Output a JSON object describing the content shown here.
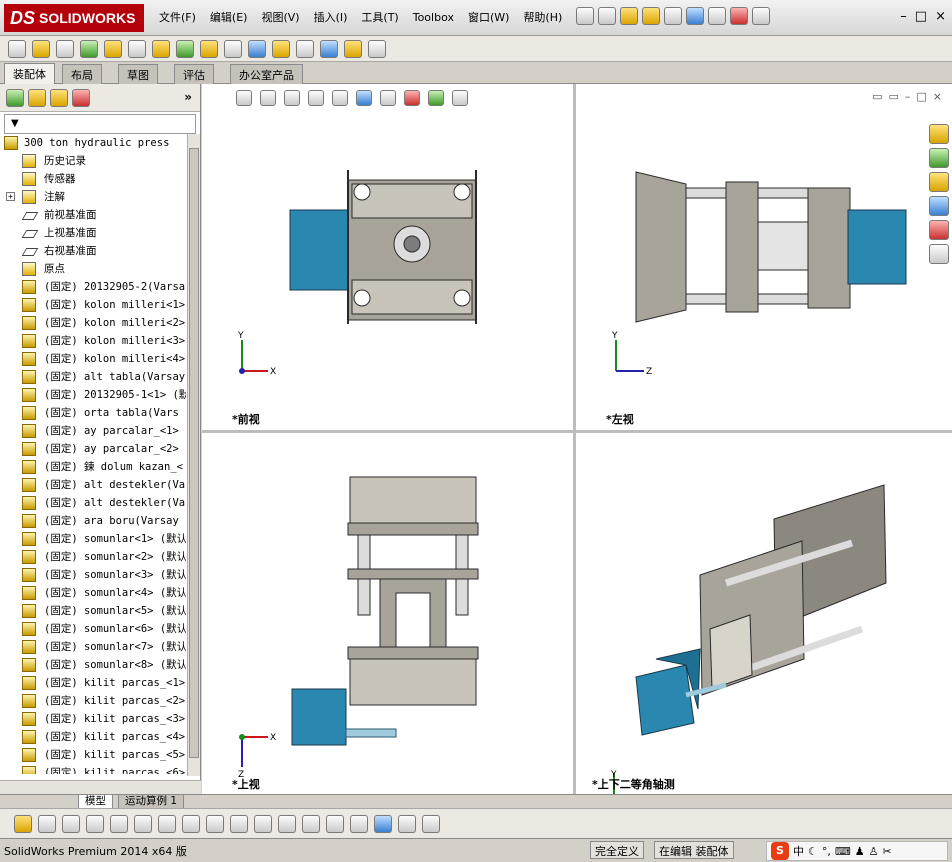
{
  "app": {
    "logo_prefix": "DS",
    "logo_text": "SOLIDWORKS"
  },
  "menu": [
    "文件(F)",
    "编辑(E)",
    "视图(V)",
    "插入(I)",
    "工具(T)",
    "Toolbox",
    "窗口(W)",
    "帮助(H)"
  ],
  "window_controls": [
    "–",
    "□",
    "×"
  ],
  "tabs": [
    "装配体",
    "布局",
    "草图",
    "评估",
    "办公室产品"
  ],
  "left_panel": {
    "more": "»",
    "filter": "▼"
  },
  "tree": {
    "root": "300 ton hydraulic press",
    "items": [
      {
        "label": "历史记录",
        "kind": "folder",
        "expand": false
      },
      {
        "label": "传感器",
        "kind": "folder",
        "expand": false
      },
      {
        "label": "注解",
        "kind": "annot",
        "expand": true
      },
      {
        "label": "前视基准面",
        "kind": "plane",
        "expand": false
      },
      {
        "label": "上视基准面",
        "kind": "plane",
        "expand": false
      },
      {
        "label": "右视基准面",
        "kind": "plane",
        "expand": false
      },
      {
        "label": "原点",
        "kind": "origin",
        "expand": false
      },
      {
        "label": "(固定) 20132905-2(Varsay",
        "kind": "part",
        "expand": false
      },
      {
        "label": "(固定) kolon milleri<1>",
        "kind": "part",
        "expand": false
      },
      {
        "label": "(固定) kolon milleri<2>",
        "kind": "part",
        "expand": false
      },
      {
        "label": "(固定) kolon milleri<3>",
        "kind": "part",
        "expand": false
      },
      {
        "label": "(固定) kolon milleri<4>",
        "kind": "part",
        "expand": false
      },
      {
        "label": "(固定) alt tabla(Varsay",
        "kind": "part",
        "expand": false
      },
      {
        "label": "(固定) 20132905-1<1> (默",
        "kind": "part",
        "expand": false
      },
      {
        "label": "(固定) orta  tabla(Vars",
        "kind": "part",
        "expand": false
      },
      {
        "label": "(固定) ay parcalar_<1>",
        "kind": "part",
        "expand": false
      },
      {
        "label": "(固定) ay parcalar_<2>",
        "kind": "part",
        "expand": false
      },
      {
        "label": "(固定) 鍊 dolum kazan_<",
        "kind": "part",
        "expand": false
      },
      {
        "label": "(固定) alt destekler(Va",
        "kind": "part",
        "expand": false
      },
      {
        "label": "(固定) alt destekler(Va",
        "kind": "part",
        "expand": false
      },
      {
        "label": "(固定) ara boru(Varsay",
        "kind": "part",
        "expand": false
      },
      {
        "label": "(固定) somunlar<1> (默认",
        "kind": "part",
        "expand": false
      },
      {
        "label": "(固定) somunlar<2> (默认",
        "kind": "part",
        "expand": false
      },
      {
        "label": "(固定) somunlar<3> (默认",
        "kind": "part",
        "expand": false
      },
      {
        "label": "(固定) somunlar<4> (默认",
        "kind": "part",
        "expand": false
      },
      {
        "label": "(固定) somunlar<5> (默认",
        "kind": "part",
        "expand": false
      },
      {
        "label": "(固定) somunlar<6> (默认",
        "kind": "part",
        "expand": false
      },
      {
        "label": "(固定) somunlar<7> (默认",
        "kind": "part",
        "expand": false
      },
      {
        "label": "(固定) somunlar<8> (默认",
        "kind": "part",
        "expand": false
      },
      {
        "label": "(固定) kilit parcas_<1>",
        "kind": "part",
        "expand": false
      },
      {
        "label": "(固定) kilit parcas_<2>",
        "kind": "part",
        "expand": false
      },
      {
        "label": "(固定) kilit parcas_<3>",
        "kind": "part",
        "expand": false
      },
      {
        "label": "(固定) kilit parcas_<4>",
        "kind": "part",
        "expand": false
      },
      {
        "label": "(固定) kilit parcas_<5>",
        "kind": "part",
        "expand": false
      },
      {
        "label": "(固定) kilit parcas <6>",
        "kind": "part",
        "expand": false
      }
    ]
  },
  "views": {
    "front": "*前视",
    "left": "*左视",
    "top": "*上视",
    "iso": "*上下二等角轴测"
  },
  "axes": {
    "x": "X",
    "y": "Y",
    "z": "Z"
  },
  "bottom_tabs": [
    "模型",
    "运动算例 1"
  ],
  "status": {
    "product": "SolidWorks Premium 2014 x64 版",
    "state": "完全定义",
    "editing": "在编辑 装配体"
  },
  "ime": {
    "logo": "S",
    "lang": "中"
  },
  "colors": {
    "part_gray": "#a8a49a",
    "dark": "#3a3a3a",
    "blue": "#2a87b0",
    "cylinder": "#9fc9dc"
  }
}
